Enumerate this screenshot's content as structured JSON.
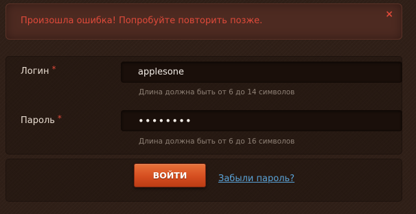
{
  "alert": {
    "message": "Произошла ошибка! Попробуйте повторить позже.",
    "close_symbol": "×",
    "close_icon": "close-icon"
  },
  "form": {
    "login": {
      "label": "Логин",
      "required_mark": "*",
      "value": "applesone",
      "hint": "Длина должна быть от 6 до 14 символов"
    },
    "password": {
      "label": "Пароль",
      "required_mark": "*",
      "value": "••••••••",
      "hint": "Длина должна быть от 6 до 16 символов"
    },
    "submit_label": "ВОЙТИ",
    "forgot_link": "Забыли пароль?"
  },
  "colors": {
    "background": "#2f1f17",
    "alert_background": "#4d2a21",
    "error_text": "#e04a3a",
    "button": "#d54e20",
    "link": "#5aa3d8",
    "hint_text": "#8e8075"
  }
}
